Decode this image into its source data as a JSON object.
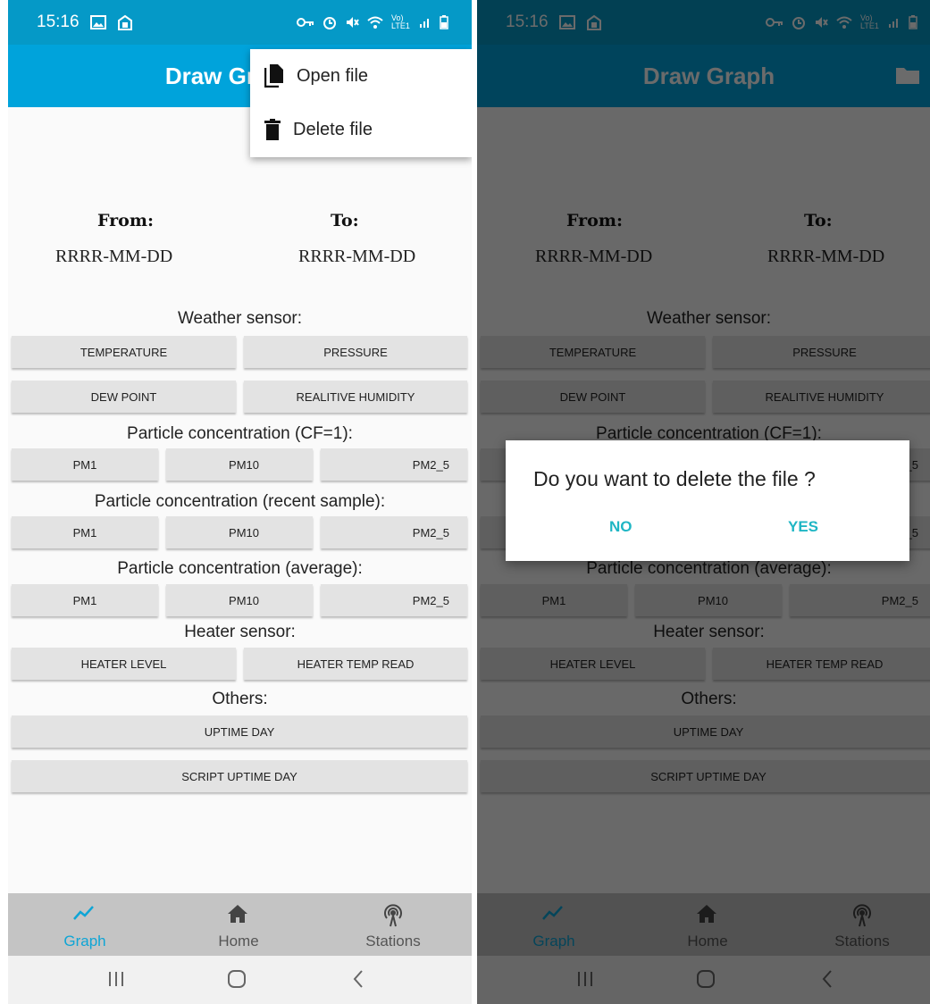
{
  "status_bar": {
    "time": "15:16",
    "network_label": "Vo) LTE1"
  },
  "toolbar": {
    "title": "Draw Graph"
  },
  "menu": {
    "items": [
      {
        "label": "Open file"
      },
      {
        "label": "Delete file"
      }
    ]
  },
  "dates": {
    "from_label": "From:",
    "to_label": "To:",
    "from_value": "RRRR-MM-DD",
    "to_value": "RRRR-MM-DD"
  },
  "sections": {
    "weather": {
      "title": "Weather sensor:",
      "buttons": [
        "TEMPERATURE",
        "PRESSURE",
        "DEW POINT",
        "REALITIVE HUMIDITY"
      ]
    },
    "pm_cf1": {
      "title": "Particle concentration (CF=1):",
      "buttons": [
        "PM1",
        "PM10",
        "PM2_5"
      ]
    },
    "pm_recent": {
      "title": "Particle concentration (recent sample):",
      "buttons": [
        "PM1",
        "PM10",
        "PM2_5"
      ]
    },
    "pm_avg": {
      "title": "Particle concentration (average):",
      "buttons": [
        "PM1",
        "PM10",
        "PM2_5"
      ]
    },
    "heater": {
      "title": "Heater sensor:",
      "buttons": [
        "HEATER LEVEL",
        "HEATER TEMP READ"
      ]
    },
    "others": {
      "title": "Others:",
      "buttons": [
        "UPTIME DAY",
        "SCRIPT UPTIME DAY"
      ]
    }
  },
  "bottom_nav": {
    "items": [
      {
        "label": "Graph",
        "icon": "graph-icon",
        "active": true
      },
      {
        "label": "Home",
        "icon": "home-icon"
      },
      {
        "label": "Stations",
        "icon": "antenna-icon"
      }
    ]
  },
  "dialog": {
    "title": "Do you want to delete the file ?",
    "no": "NO",
    "yes": "YES"
  },
  "colors": {
    "primary": "#00a3db",
    "status_bar": "#0599c7",
    "accent": "#1fb6c4",
    "button": "#e3e3e3",
    "nav_bg": "#c4c4c4"
  }
}
